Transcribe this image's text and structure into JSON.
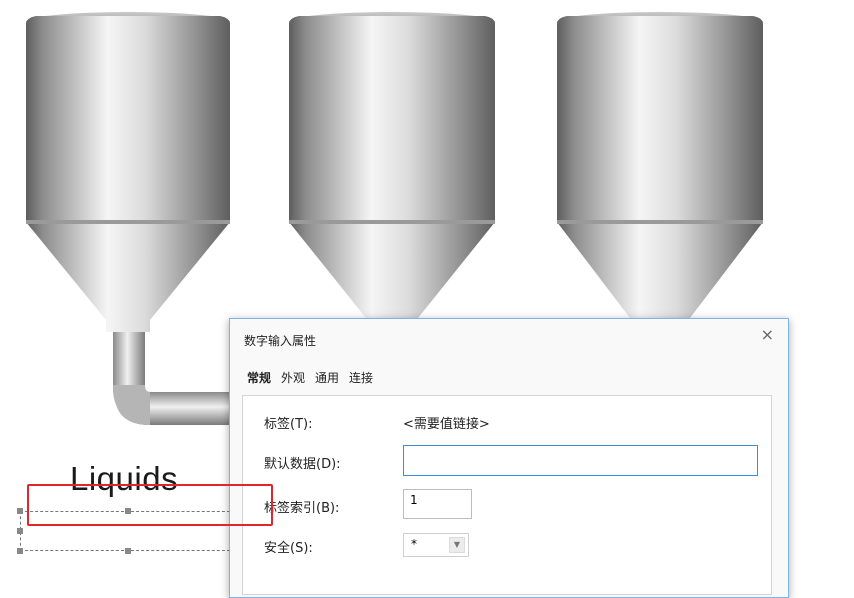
{
  "canvas": {
    "label": "Liquids",
    "silos": [
      "silo-1",
      "silo-2",
      "silo-3"
    ]
  },
  "dialog": {
    "title": "数字输入属性",
    "close_icon": "×",
    "tabs": [
      {
        "label": "常规",
        "active": true
      },
      {
        "label": "外观",
        "active": false
      },
      {
        "label": "通用",
        "active": false
      },
      {
        "label": "连接",
        "active": false
      }
    ],
    "fields": {
      "tag_label": "标签(T):",
      "tag_value": "<需要值链接>",
      "default_label": "默认数据(D):",
      "default_value": "",
      "index_label": "标签索引(B):",
      "index_value": "1",
      "security_label": "安全(S):",
      "security_value": "*",
      "security_arrow": "▼"
    }
  },
  "colors": {
    "highlight": "#e0262b",
    "focus_border": "#3d8bd6"
  }
}
